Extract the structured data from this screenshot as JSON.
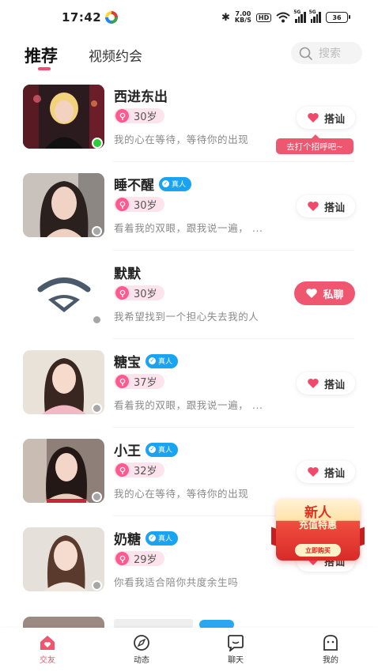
{
  "status_bar": {
    "time": "17:42",
    "net_speed": "7.00",
    "net_unit": "KB/S",
    "hd_label": "HD",
    "sig1_label": "5G",
    "sig2_label": "5G",
    "battery": "36"
  },
  "header": {
    "tab_recommend": "推荐",
    "tab_video_date": "视频约会",
    "search_placeholder": "搜索"
  },
  "list": {
    "items": [
      {
        "name": "西进东出",
        "verified": false,
        "age": "30岁",
        "bio": "我的心在等待，等待你的出现",
        "action": "搭讪",
        "online": true
      },
      {
        "name": "睡不醒",
        "verified": true,
        "verified_label": "真人",
        "age": "30岁",
        "bio": "看着我的双眼，跟我说一遍，  ...",
        "action": "搭讪",
        "online": false
      },
      {
        "name": "默默",
        "verified": false,
        "age": "30岁",
        "bio": "我希望找到一个担心失去我的人",
        "action": "私聊",
        "online": false
      },
      {
        "name": "糖宝",
        "verified": true,
        "verified_label": "真人",
        "age": "37岁",
        "bio": "看着我的双眼，跟我说一遍，  ...",
        "action": "搭讪",
        "online": false
      },
      {
        "name": "小王",
        "verified": true,
        "verified_label": "真人",
        "age": "32岁",
        "bio": "我的心在等待，等待你的出现",
        "action": "搭讪",
        "online": false
      },
      {
        "name": "奶糖",
        "verified": true,
        "verified_label": "真人",
        "age": "29岁",
        "bio": "你看我适合陪你共度余生吗",
        "action": "搭讪",
        "online": false
      }
    ],
    "hint_bubble": "去打个招呼吧~"
  },
  "promo": {
    "title": "新人",
    "subtitle": "充值特惠",
    "button": "立即购买"
  },
  "bottom_nav": {
    "items": [
      {
        "label": "交友",
        "icon": "home-heart-icon",
        "active": true
      },
      {
        "label": "动态",
        "icon": "compass-icon",
        "active": false
      },
      {
        "label": "聊天",
        "icon": "chat-bubble-icon",
        "active": false
      },
      {
        "label": "我的",
        "icon": "profile-ghost-icon",
        "active": false
      }
    ]
  },
  "colors": {
    "accent": "#ef5670",
    "verified": "#1aa3f0",
    "online": "#2ecc40",
    "age_bg": "#fde4ec"
  }
}
